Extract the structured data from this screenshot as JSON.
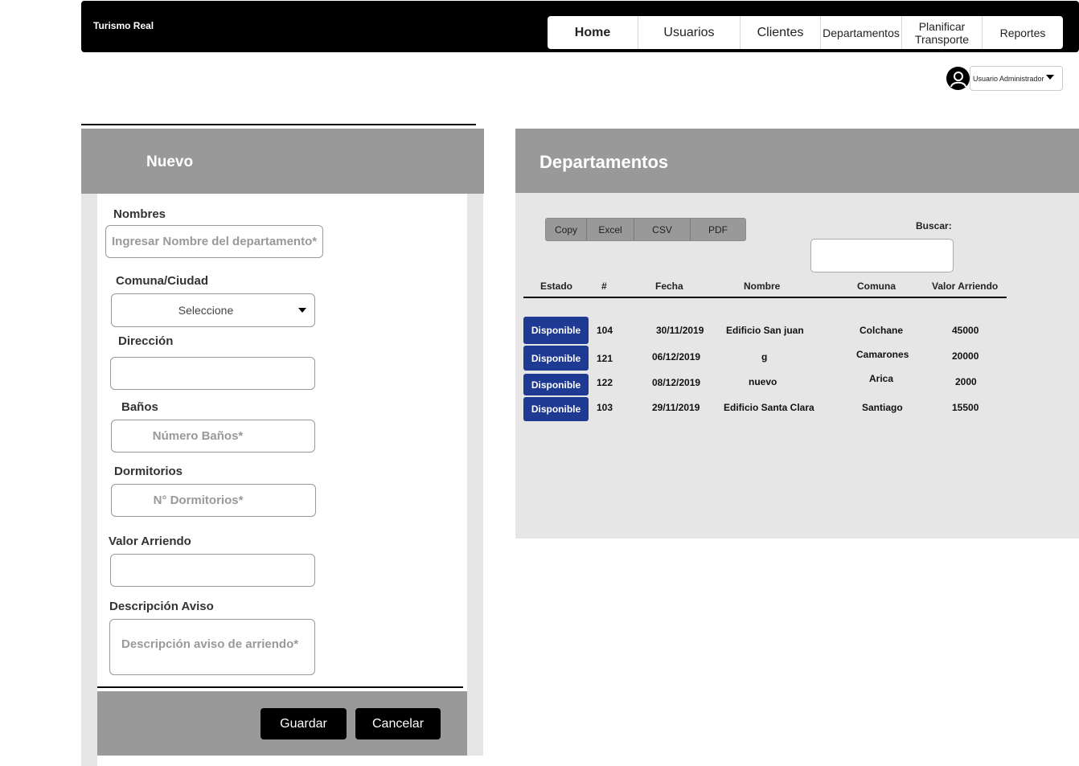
{
  "header": {
    "brand": "Turismo Real",
    "nav": [
      "Home",
      "Usuarios",
      "Clientes",
      "Departamentos",
      "Planificar Transporte",
      "Reportes"
    ],
    "active_nav": "Home"
  },
  "user": {
    "name": "Usuario Administrador",
    "icon": "user-icon"
  },
  "form": {
    "title": "Nuevo",
    "nombres_label": "Nombres",
    "nombres_placeholder": "Ingresar Nombre del departamento*",
    "comuna_label": "Comuna/Ciudad",
    "comuna_value": "Seleccione",
    "direccion_label": "Dirección",
    "banos_label": "Baños",
    "banos_placeholder": "Número Baños*",
    "dormitorios_label": "Dormitorios",
    "dormitorios_placeholder": "N° Dormitorios*",
    "valor_label": "Valor Arriendo",
    "descripcion_label": "Descripción Aviso",
    "descripcion_placeholder": "Descripción aviso de arriendo*",
    "save_label": "Guardar",
    "cancel_label": "Cancelar"
  },
  "table": {
    "title": "Departamentos",
    "export_buttons": [
      "Copy",
      "Excel",
      "CSV",
      "PDF"
    ],
    "search_label": "Buscar:",
    "columns": [
      "Estado",
      "#",
      "Fecha",
      "Nombre",
      "Comuna",
      "Valor Arriendo"
    ],
    "rows": [
      {
        "estado": "Disponible",
        "id": "104",
        "fecha": "30/11/2019",
        "nombre": "Edificio San juan",
        "comuna": "Colchane",
        "valor": "45000"
      },
      {
        "estado": "Disponible",
        "id": "121",
        "fecha": "06/12/2019",
        "nombre": "g",
        "comuna": "Camarones",
        "valor": "20000"
      },
      {
        "estado": "Disponible",
        "id": "122",
        "fecha": "08/12/2019",
        "nombre": "nuevo",
        "comuna": "Arica",
        "valor": "2000"
      },
      {
        "estado": "Disponible",
        "id": "103",
        "fecha": "29/11/2019",
        "nombre": "Edificio Santa Clara",
        "comuna": "Santiago",
        "valor": "15500"
      }
    ],
    "badge_color": "#1f3a93"
  }
}
